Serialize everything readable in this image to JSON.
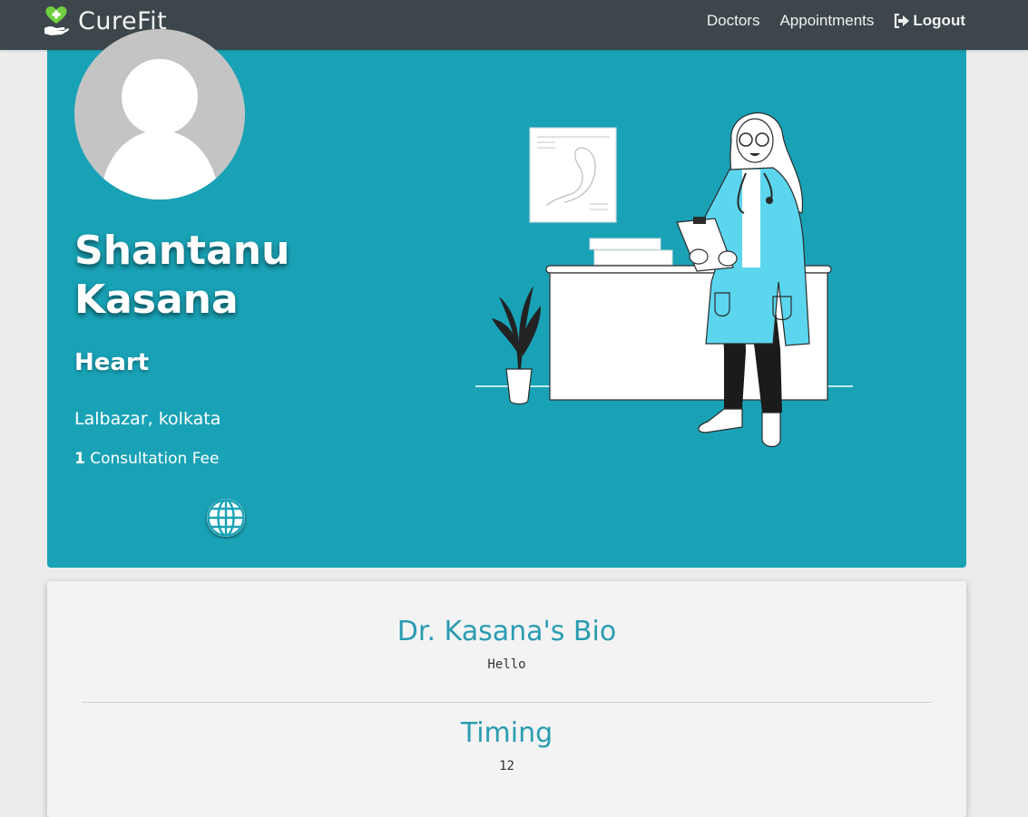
{
  "navbar": {
    "brand": "CureFit",
    "links": [
      {
        "label": "Doctors"
      },
      {
        "label": "Appointments"
      },
      {
        "label": "Logout"
      }
    ]
  },
  "profile": {
    "name_first": "Shantanu",
    "name_last": "Kasana",
    "specialty": "Heart",
    "location": "Lalbazar, kolkata",
    "fee_value": "1",
    "fee_label": "Consultation Fee"
  },
  "bio": {
    "title": "Dr. Kasana's Bio",
    "text": "Hello"
  },
  "timing": {
    "title": "Timing",
    "value": "12"
  },
  "colors": {
    "navbar": "#3c464b",
    "hero": "#19a2b6",
    "accent": "#2a9cb2",
    "background": "#ececec"
  },
  "icons": [
    "heart-hand-logo-icon",
    "logout-icon",
    "globe-icon"
  ]
}
